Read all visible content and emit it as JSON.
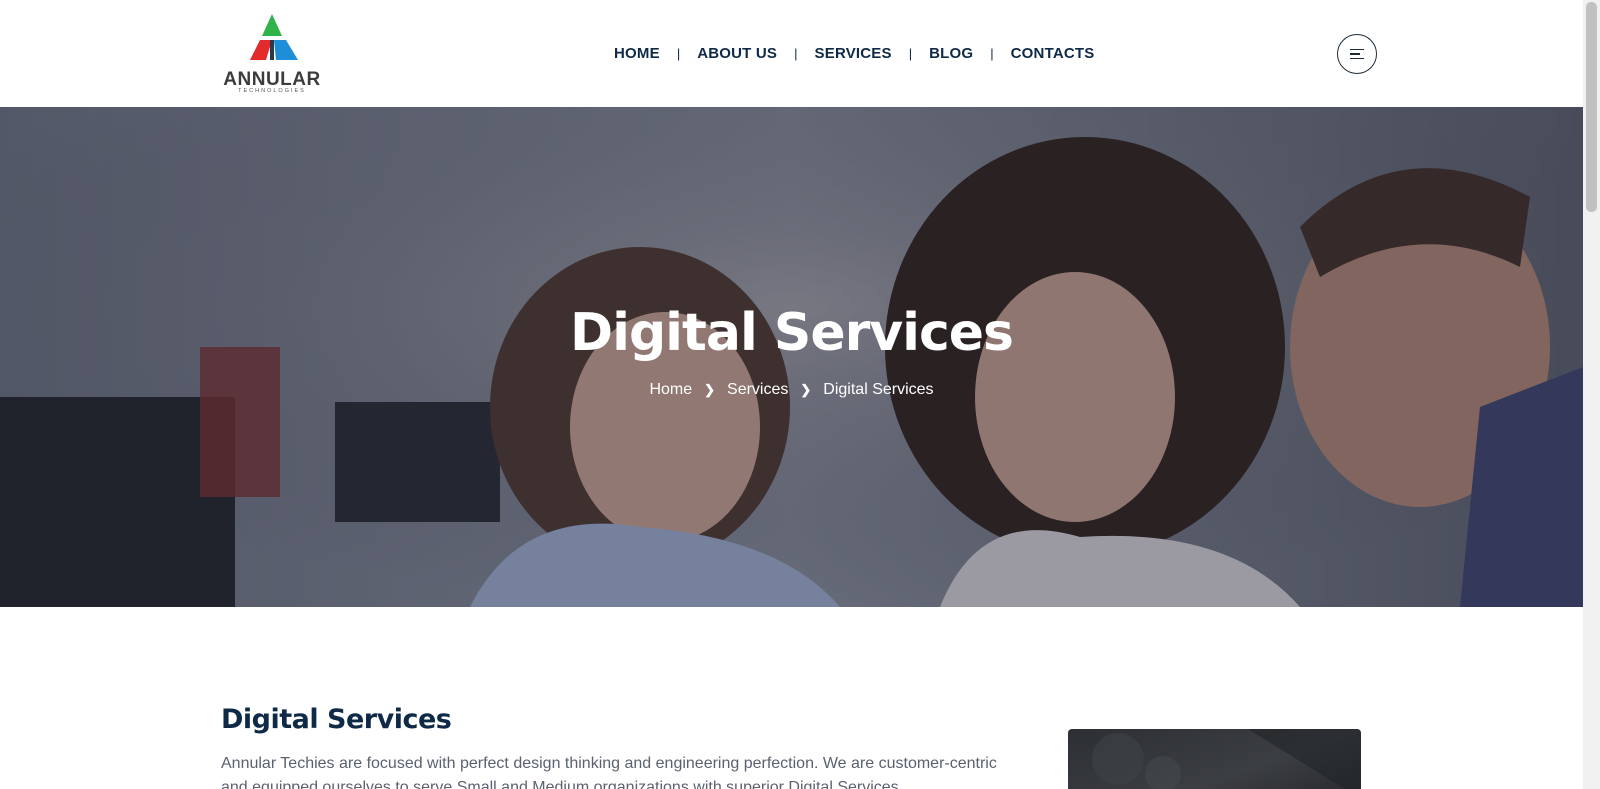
{
  "brand": {
    "logo_text": "ANNULAR",
    "logo_subtext": "TECHNOLOGIES",
    "colors": {
      "green": "#2fb34a",
      "red": "#e42b2b",
      "blue": "#1f8ed8",
      "navy": "#0e2a47"
    }
  },
  "nav": {
    "items": [
      {
        "label": "HOME"
      },
      {
        "label": "ABOUT US"
      },
      {
        "label": "SERVICES"
      },
      {
        "label": "BLOG"
      },
      {
        "label": "CONTACTS"
      }
    ],
    "separator": "|",
    "menu_icon": "hamburger-menu-icon"
  },
  "hero": {
    "title": "Digital Services",
    "breadcrumb": [
      "Home",
      "Services",
      "Digital Services"
    ],
    "breadcrumb_separator_icon": "chevron-right-icon"
  },
  "content": {
    "title": "Digital Services",
    "paragraph": "Annular Techies are focused with perfect design thinking and engineering perfection. We are customer-centric and equipped ourselves to serve Small and Medium organizations with superior Digital Services."
  }
}
